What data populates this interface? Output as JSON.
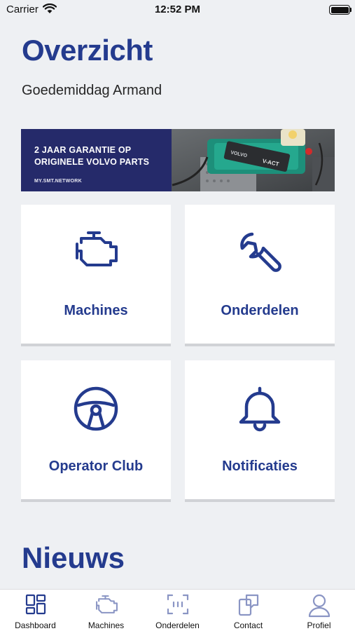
{
  "status_bar": {
    "carrier": "Carrier",
    "time": "12:52 PM"
  },
  "header": {
    "title": "Overzicht",
    "greeting": "Goedemiddag Armand"
  },
  "banner": {
    "line1": "2 JAAR GARANTIE OP",
    "line2": "ORIGINELE VOLVO PARTS",
    "url": "MY.SMT.NETWORK",
    "engine_brand": "VOLVO",
    "engine_badge": "V-ACT"
  },
  "tiles": [
    {
      "label": "Machines",
      "icon": "engine-icon"
    },
    {
      "label": "Onderdelen",
      "icon": "wrench-icon"
    },
    {
      "label": "Operator Club",
      "icon": "steering-wheel-icon"
    },
    {
      "label": "Notificaties",
      "icon": "bell-icon"
    }
  ],
  "news": {
    "title": "Nieuws"
  },
  "tab_bar": {
    "items": [
      {
        "label": "Dashboard",
        "icon": "dashboard-icon"
      },
      {
        "label": "Machines",
        "icon": "engine-icon"
      },
      {
        "label": "Onderdelen",
        "icon": "scan-icon"
      },
      {
        "label": "Contact",
        "icon": "contact-icon"
      },
      {
        "label": "Profiel",
        "icon": "profile-icon"
      }
    ]
  },
  "colors": {
    "brand": "#243b8e",
    "background": "#eef0f3",
    "banner": "#252a6a",
    "tile": "#ffffff"
  }
}
